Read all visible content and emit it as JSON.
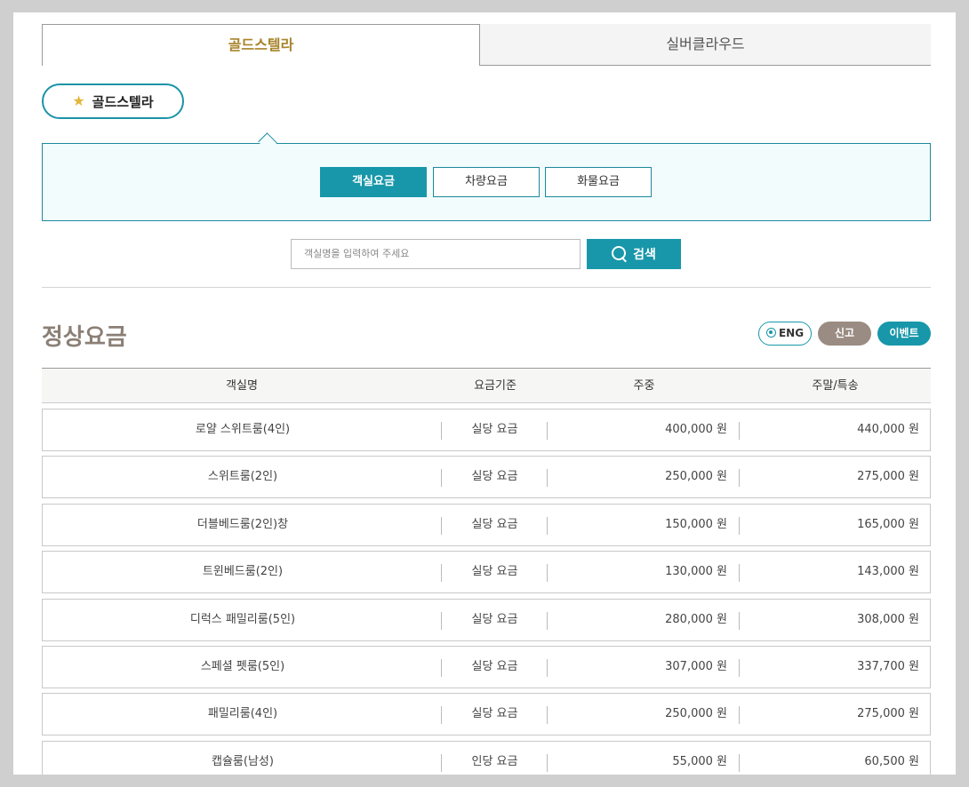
{
  "ship_tabs": {
    "active": "골드스텔라",
    "inactive": "실버클라우드"
  },
  "ship_pill": {
    "label": "골드스텔라",
    "icon": "star-icon"
  },
  "fare_types": [
    "객실요금",
    "차량요금",
    "화물요금"
  ],
  "search": {
    "placeholder": "객실명을 입력하여 주세요",
    "button_label": "검색"
  },
  "section_title": "정상요금",
  "badges": {
    "eng": "ENG",
    "report": "신고",
    "event": "이벤트"
  },
  "table": {
    "headers": [
      "객실명",
      "요금기준",
      "주중",
      "주말/특송"
    ],
    "rows": [
      [
        "로얄 스위트룸(4인)",
        "실당 요금",
        "400,000 원",
        "440,000 원"
      ],
      [
        "스위트룸(2인)",
        "실당 요금",
        "250,000 원",
        "275,000 원"
      ],
      [
        "더블베드룸(2인)창",
        "실당 요금",
        "150,000 원",
        "165,000 원"
      ],
      [
        "트윈베드룸(2인)",
        "실당 요금",
        "130,000 원",
        "143,000 원"
      ],
      [
        "디럭스 패밀리룸(5인)",
        "실당 요금",
        "280,000 원",
        "308,000 원"
      ],
      [
        "스페셜 펫룸(5인)",
        "실당 요금",
        "307,000 원",
        "337,700 원"
      ],
      [
        "패밀리룸(4인)",
        "실당 요금",
        "250,000 원",
        "275,000 원"
      ],
      [
        "캡슐룸(남성)",
        "인당 요금",
        "55,000 원",
        "60,500 원"
      ]
    ]
  },
  "colors": {
    "accent": "#1797a9",
    "gold": "#a8842a",
    "title": "#8b7f76",
    "report_badge": "#9a8c82"
  }
}
